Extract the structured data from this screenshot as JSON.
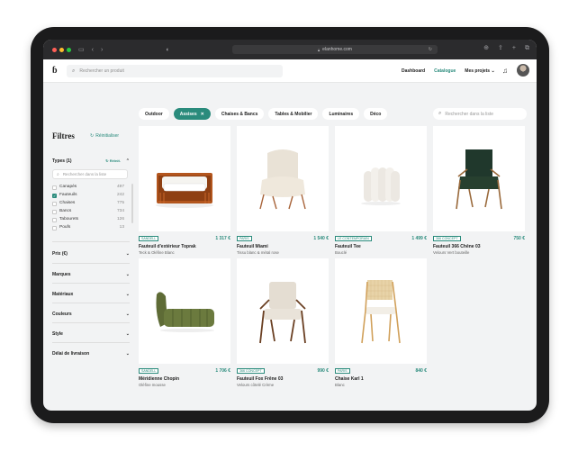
{
  "browser": {
    "url": "elanhome.com"
  },
  "header": {
    "logo": "ɓ",
    "search_placeholder": "Rechercher un produit",
    "nav": [
      "Dashboard",
      "Catalogue",
      "Mes projets ⌄"
    ],
    "active_nav": "Catalogue"
  },
  "categories": {
    "chips": [
      "Outdoor",
      "Assises",
      "Chaises & Bancs",
      "Tables & Mobilier",
      "Luminaires",
      "Déco"
    ],
    "selected": "Assises",
    "list_search_placeholder": "Rechercher dans la liste"
  },
  "sidebar": {
    "title": "Filtres",
    "reset_all": "Réinitialiser",
    "types_label": "Types (1)",
    "types_reset": "Réinit.",
    "types_search_placeholder": "Rechercher dans la liste",
    "types": [
      {
        "label": "Canapés",
        "count": "497",
        "checked": false
      },
      {
        "label": "Fauteuils",
        "count": "242",
        "checked": true
      },
      {
        "label": "Chaises",
        "count": "775",
        "checked": false
      },
      {
        "label": "Bancs",
        "count": "734",
        "checked": false
      },
      {
        "label": "Tabourets",
        "count": "126",
        "checked": false
      },
      {
        "label": "Poufs",
        "count": "13",
        "checked": false
      }
    ],
    "sections": [
      "Prix (€)",
      "Marques",
      "Matériaux",
      "Couleurs",
      "Style",
      "Délai de livraison"
    ]
  },
  "products": [
    {
      "brand": "SANDELL",
      "price": "1 317 €",
      "name": "Fauteuil d'extérieur Toprak",
      "desc": "Teck & Oléfine Blanc",
      "image": "outdoor-armchair"
    },
    {
      "brand": "PARIS",
      "price": "1 540 €",
      "name": "Fauteuil Miami",
      "desc": "Tissu blanc & métal rose",
      "image": "sherpa-armchair"
    },
    {
      "brand": "LE CONTEMPORAIN",
      "price": "1 499 €",
      "name": "Fauteuil Tee",
      "desc": "Bouclé",
      "image": "pouf-armchair"
    },
    {
      "brand": "366 CONCEPT",
      "price": "750 €",
      "name": "Fauteuil 366 Chêne 03",
      "desc": "Velours Vert bouteille",
      "image": "green-armchair"
    },
    {
      "brand": "SANDELL",
      "price": "1 706 €",
      "name": "Méridienne Chopin",
      "desc": "Oléfine mousse",
      "image": "green-lounger"
    },
    {
      "brand": "366 CONCEPT",
      "price": "990 €",
      "name": "Fauteuil Fox Frêne 03",
      "desc": "Velours côtelé Crème",
      "image": "fox-armchair"
    },
    {
      "brand": "PARIS",
      "price": "840 €",
      "name": "Chaise Karl 1",
      "desc": "Blanc",
      "image": "cane-chair"
    }
  ]
}
